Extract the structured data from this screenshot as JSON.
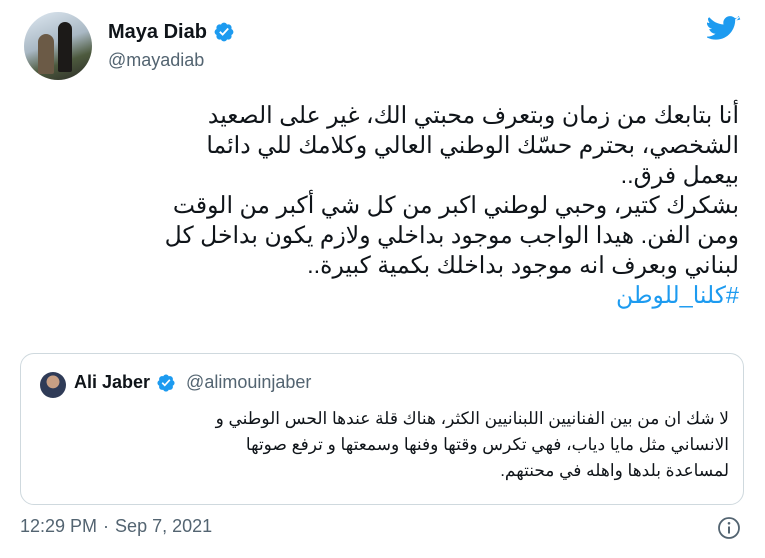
{
  "author": {
    "display_name": "Maya Diab",
    "handle": "@mayadiab"
  },
  "tweet": {
    "lines": [
      "أنا بتابعك من زمان وبتعرف محبتي الك، غير على الصعيد",
      "الشخصي، بحترم حسّك الوطني العالي وكلامك للي دائما",
      "بيعمل فرق..",
      "بشكرك كتير، وحبي لوطني اكبر من كل شي أكبر من الوقت",
      "ومن الفن. هيدا الواجب موجود بداخلي ولازم يكون بداخل كل",
      "لبناني وبعرف انه موجود بداخلك بكمية كبيرة.."
    ],
    "hashtag": "#كلنا_للوطن"
  },
  "quoted": {
    "display_name": "Ali Jaber",
    "handle": "@alimouinjaber",
    "lines": [
      "لا شك ان من بين الفنانيين اللبنانيين الكثر، هناك قلة عندها الحس الوطني و",
      "الانساني مثل مايا دياب، فهي تكرس وقتها وفنها وسمعتها و ترفع صوتها",
      "لمساعدة بلدها واهله في محنتهم."
    ]
  },
  "meta": {
    "time": "12:29 PM",
    "separator": "·",
    "date": "Sep 7, 2021"
  },
  "colors": {
    "accent": "#1d9bf0",
    "secondary_text": "#536471",
    "border": "#cfd9de"
  },
  "icons": [
    "verified-badge-icon",
    "twitter-bird-icon",
    "info-icon"
  ]
}
